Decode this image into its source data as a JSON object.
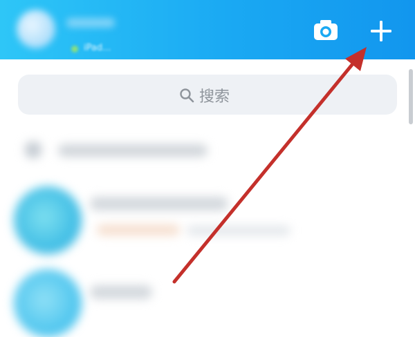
{
  "header": {
    "status_text": "iPad...",
    "camera_icon": "camera-icon",
    "add_icon": "plus-icon",
    "background_color": "#1aa9f3"
  },
  "search": {
    "label": "搜索",
    "icon": "search-icon"
  },
  "annotation": {
    "arrow_color": "#c4302b",
    "target": "add-button"
  }
}
